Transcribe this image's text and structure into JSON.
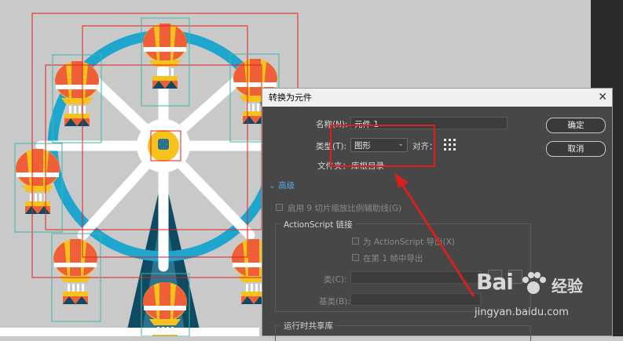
{
  "dialog": {
    "title": "转换为元件",
    "name_label": "名称(N):",
    "name_value": "元件 1",
    "type_label": "类型(T):",
    "type_value": "图形",
    "align_label": "对齐：",
    "folder_label": "文件夹：",
    "folder_value": "库根目录",
    "ok_label": "确定",
    "cancel_label": "取消",
    "advanced_label": "高级",
    "nine_slice_label": "启用 9 切片缩放比例辅助线(G)",
    "actionscript_group": "ActionScript 链接",
    "export_as_label": "为 ActionScript 导出(X)",
    "export_frame_label": "在第 1 帧中导出",
    "class_label": "类(C):",
    "base_class_label": "基类(B):",
    "runtime_label": "运行时共享库"
  },
  "watermark": {
    "logo": "Bai",
    "logo_cn": "经验",
    "url": "jingyan.baidu.com"
  },
  "colors": {
    "wheel_rim": "#1fa6cf",
    "stand": "#0f4a63",
    "highlight": "#e21d1d",
    "dialog_bg": "#474747"
  }
}
